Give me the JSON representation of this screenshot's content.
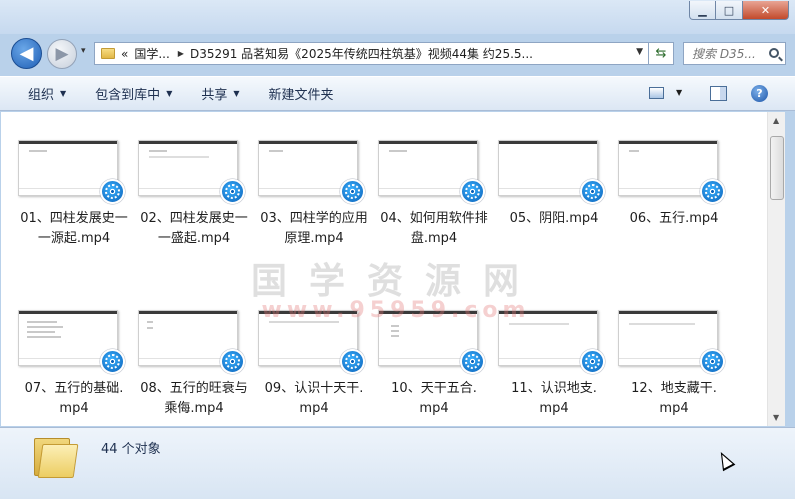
{
  "window": {
    "minimize": "▁",
    "maximize": "□",
    "close": "✕"
  },
  "nav": {
    "back": "◀",
    "forward": "▶",
    "recent": "▾",
    "address": {
      "overflow": "«",
      "segments": [
        "国学...",
        "D35291 品茗知易《2025年传统四柱筑基》视频44集 约25.5..."
      ]
    },
    "refresh": "⇆",
    "search_placeholder": "搜索 D35..."
  },
  "toolbar": {
    "items": [
      {
        "label": "组织",
        "has_menu": true
      },
      {
        "label": "包含到库中",
        "has_menu": true
      },
      {
        "label": "共享",
        "has_menu": true
      },
      {
        "label": "新建文件夹",
        "has_menu": false
      }
    ],
    "help": "?"
  },
  "files": [
    {
      "label": "01、四柱发展史一\n一源起.mp4"
    },
    {
      "label": "02、四柱发展史一\n一盛起.mp4"
    },
    {
      "label": "03、四柱学的应用\n原理.mp4"
    },
    {
      "label": "04、如何用软件排\n盘.mp4"
    },
    {
      "label": "05、阴阳.mp4"
    },
    {
      "label": "06、五行.mp4"
    },
    {
      "label": "07、五行的基础.\nmp4"
    },
    {
      "label": "08、五行的旺衰与\n乘侮.mp4"
    },
    {
      "label": "09、认识十天干.\nmp4"
    },
    {
      "label": "10、天干五合.\nmp4"
    },
    {
      "label": "11、认识地支.\nmp4"
    },
    {
      "label": "12、地支藏干.\nmp4"
    }
  ],
  "watermark": {
    "text": "国学资源网",
    "url": "www.95959.com"
  },
  "status": {
    "count_text": "44 个对象"
  }
}
